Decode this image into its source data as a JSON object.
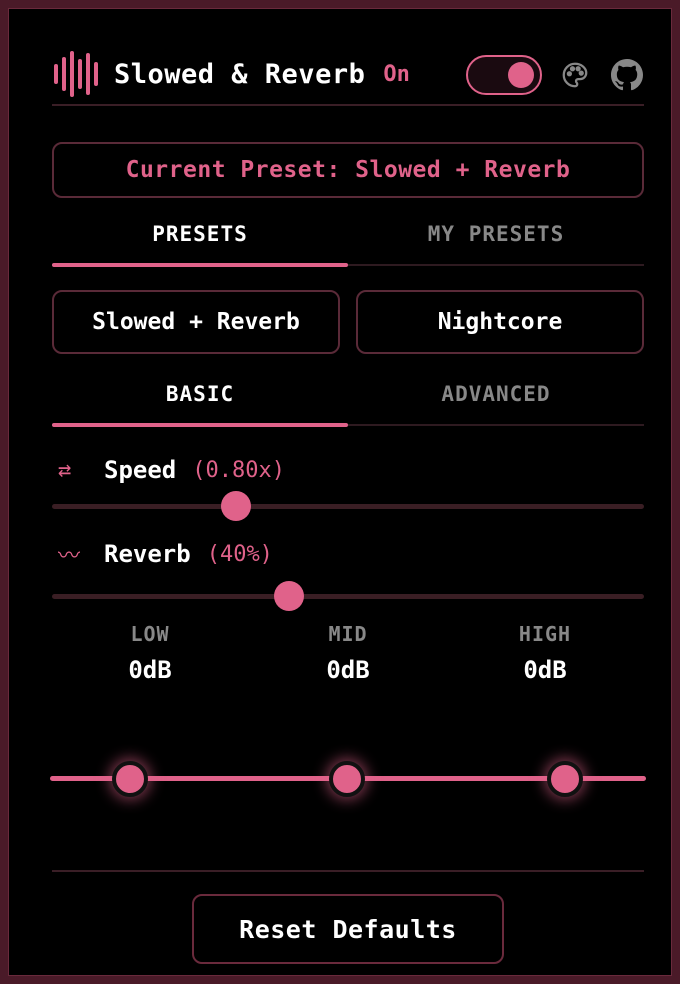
{
  "header": {
    "title": "Slowed & Reverb",
    "status_label": "On",
    "toggle_on": true,
    "icons": [
      "waveform-logo-icon",
      "palette-icon",
      "github-icon"
    ]
  },
  "current_preset": {
    "label": "Current Preset: Slowed + Reverb"
  },
  "preset_tabs": [
    {
      "label": "PRESETS",
      "active": true
    },
    {
      "label": "MY PRESETS",
      "active": false
    }
  ],
  "presets": [
    {
      "label": "Slowed + Reverb"
    },
    {
      "label": "Nightcore"
    }
  ],
  "mode_tabs": [
    {
      "label": "BASIC",
      "active": true
    },
    {
      "label": "ADVANCED",
      "active": false
    }
  ],
  "params": {
    "speed": {
      "icon": "⇄",
      "label": "Speed",
      "value_text": "(0.80x)",
      "level": 0.31
    },
    "reverb": {
      "icon": "〰",
      "label": "Reverb",
      "value_text": "(40%)",
      "level": 0.4
    }
  },
  "eq": [
    {
      "label": "LOW",
      "value": "0dB"
    },
    {
      "label": "MID",
      "value": "0dB"
    },
    {
      "label": "HIGH",
      "value": "0dB"
    }
  ],
  "footer": {
    "reset_label": "Reset Defaults"
  },
  "colors": {
    "accent": "#e0628a",
    "background": "#000000",
    "frame": "#4a1a28"
  }
}
